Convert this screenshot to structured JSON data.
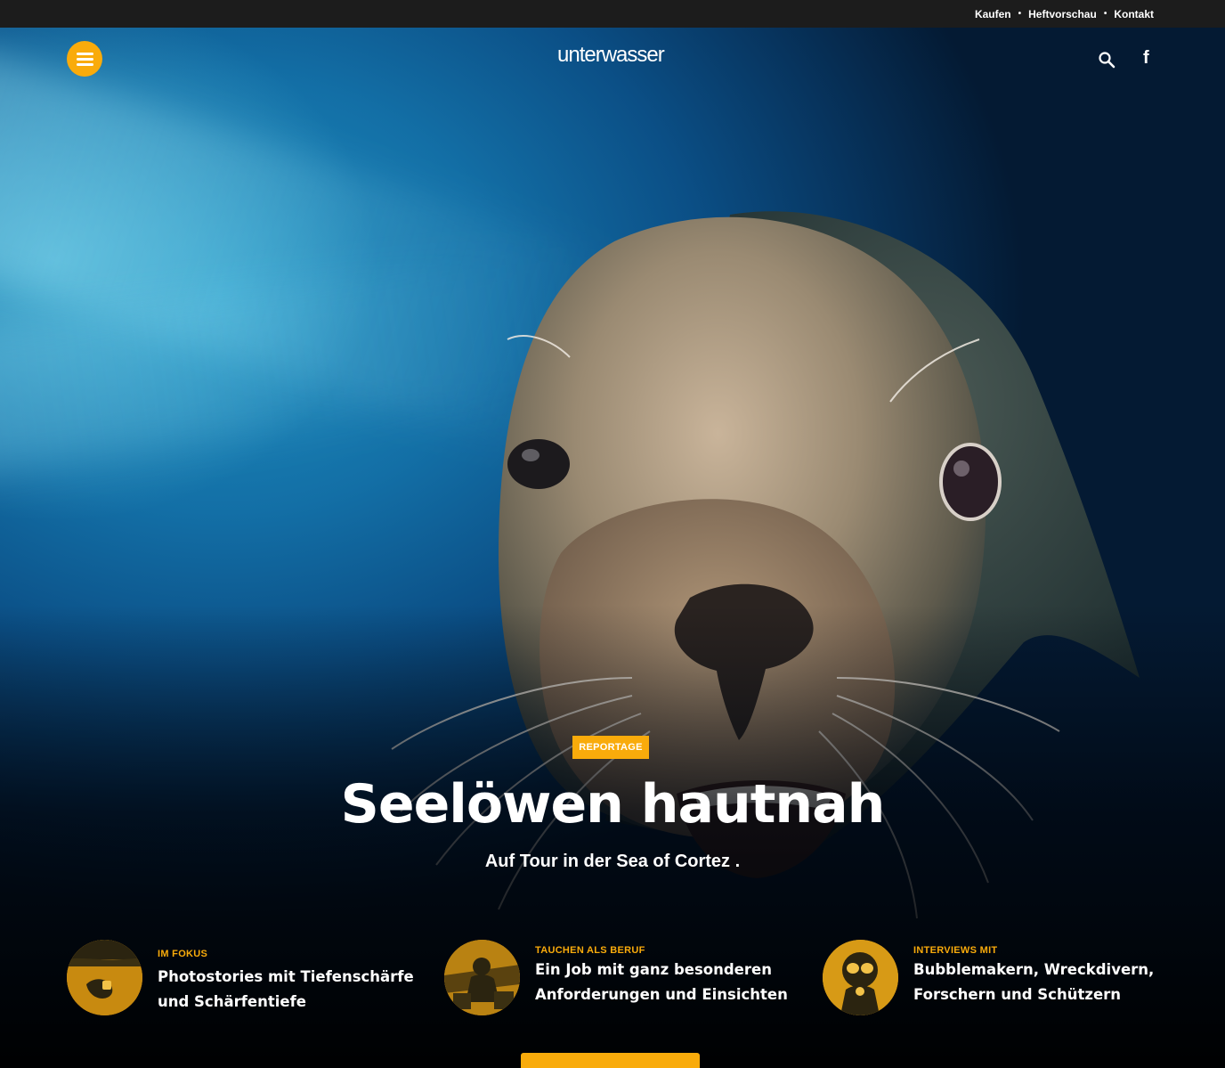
{
  "topbar": {
    "links": [
      "Kaufen",
      "Heftvorschau",
      "Kontakt"
    ],
    "separator": "•"
  },
  "header": {
    "logo": "unterwasser",
    "menu_icon": "hamburger-icon",
    "search_icon": "search-icon",
    "social_icon": "facebook-icon",
    "social_glyph": "f"
  },
  "hero": {
    "badge": "REPORTAGE",
    "title": "Seelöwen hautnah",
    "subtitle": "Auf Tour in der Sea of Cortez ."
  },
  "teasers": [
    {
      "kicker": "IM FOKUS",
      "title_line1": "Photostories mit Tiefenschärfe",
      "title_line2": "und Schärfentiefe"
    },
    {
      "kicker": "TAUCHEN ALS BERUF",
      "title_line1": "Ein Job mit ganz besonderen",
      "title_line2": "Anforderungen und Einsichten"
    },
    {
      "kicker": "INTERVIEWS MIT",
      "title_line1": "Bubblemakern, Wreckdivern,",
      "title_line2": "Forschern und Schützern"
    }
  ],
  "colors": {
    "accent": "#f9ab0b",
    "topbar": "#1c1c1c",
    "water": "#0b4f86"
  }
}
